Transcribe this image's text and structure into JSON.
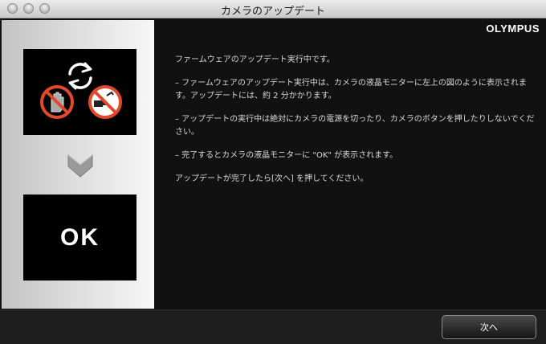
{
  "window": {
    "title": "カメラのアップデート"
  },
  "brand": {
    "logo_text": "OLYMPUS"
  },
  "left_panel": {
    "ok_label": "OK"
  },
  "instructions": {
    "lines": [
      "ファームウェアのアップデート実行中です。",
      "– ファームウェアのアップデート実行中は、カメラの液晶モニターに左上の図のように表示されます。アップデートには、約 2 分かかります。",
      "– アップデートの実行中は絶対にカメラの電源を切ったり、カメラのボタンを押したりしないでください。",
      "– 完了するとカメラの液晶モニターに \"OK\" が表示されます。",
      "アップデートが完了したら[次へ] を押してください。"
    ]
  },
  "footer": {
    "next_label": "次へ"
  },
  "colors": {
    "forbidden_red": "#e04a2a",
    "panel_bg": "#111111",
    "left_panel_gradient": "#c3c3c3"
  }
}
